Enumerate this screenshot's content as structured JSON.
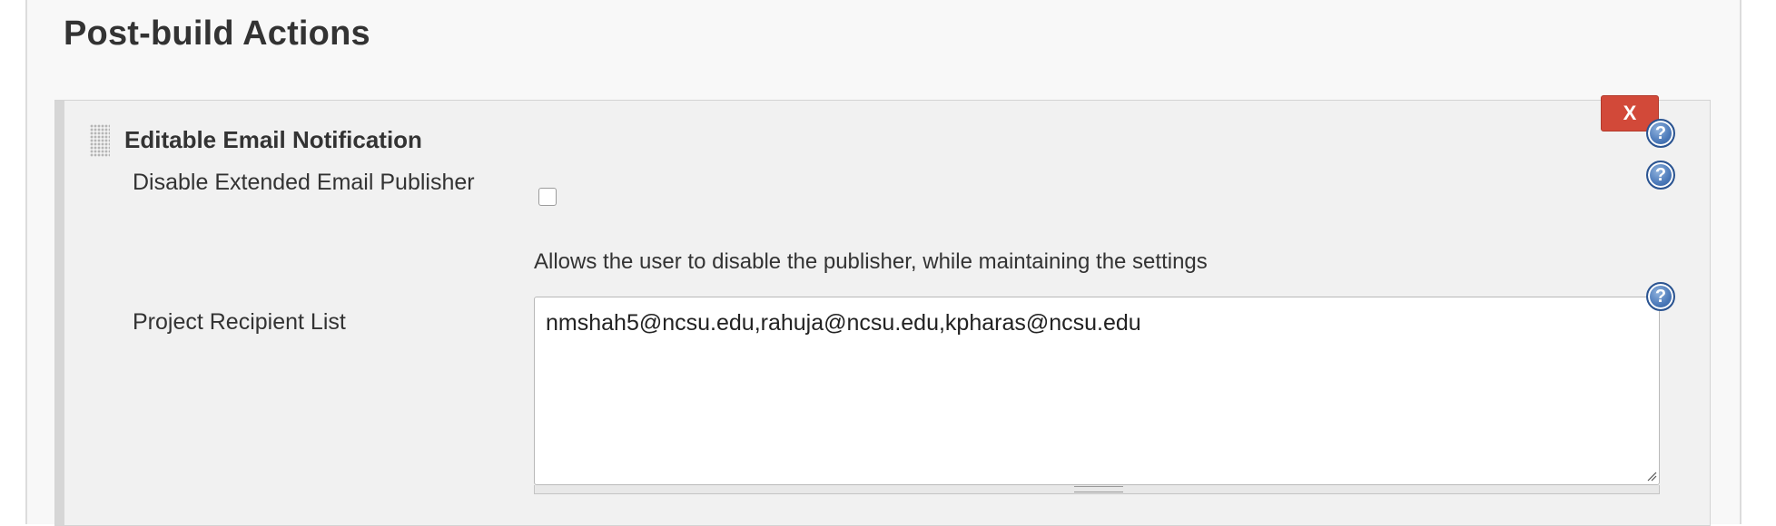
{
  "section": {
    "title": "Post-build Actions"
  },
  "publisher": {
    "title": "Editable Email Notification",
    "delete_label": "X",
    "help_symbol": "?",
    "fields": {
      "disable": {
        "label": "Disable Extended Email Publisher",
        "checked": false,
        "description": "Allows the user to disable the publisher, while maintaining the settings"
      },
      "recipients": {
        "label": "Project Recipient List",
        "value": "nmshah5@ncsu.edu,rahuja@ncsu.edu,kpharas@ncsu.edu"
      }
    }
  },
  "colors": {
    "delete_button": "#d24939",
    "help_icon": "#4a78b8",
    "panel_background": "#f1f1f1"
  },
  "icons": {
    "drag": "drag-handle-icon",
    "help": "help-icon",
    "delete": "close-icon"
  }
}
